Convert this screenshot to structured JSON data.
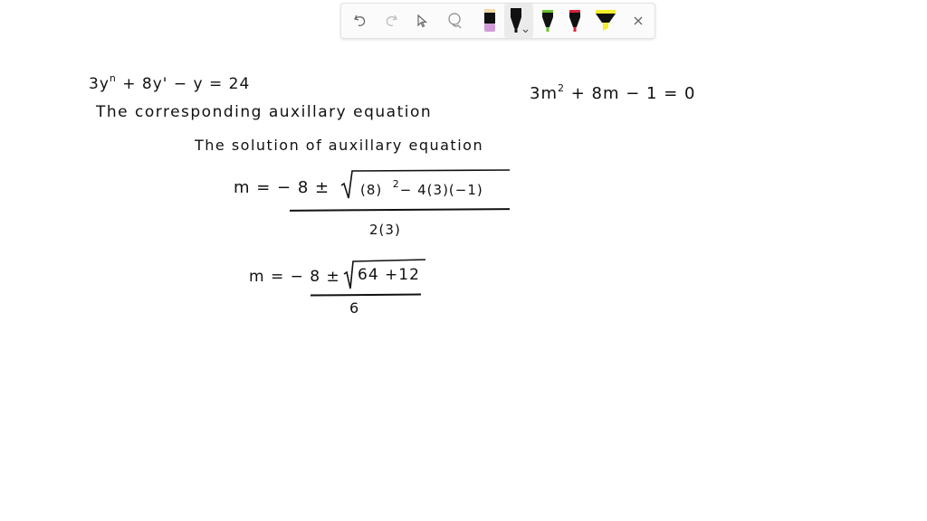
{
  "toolbar": {
    "tools": [
      {
        "name": "undo",
        "icon": "undo-icon"
      },
      {
        "name": "redo",
        "icon": "redo-icon"
      },
      {
        "name": "select",
        "icon": "cursor-icon"
      },
      {
        "name": "lasso",
        "icon": "lasso-icon"
      },
      {
        "name": "eraser-pen",
        "icon": "pen-icon",
        "color": "#cf9ad6",
        "cap_color": "#f1d9a8"
      },
      {
        "name": "black-pen",
        "icon": "pen-icon",
        "color": "#111111",
        "active": true
      },
      {
        "name": "green-pen",
        "icon": "pen-icon",
        "color": "#6bbf2e"
      },
      {
        "name": "red-pen",
        "icon": "pen-icon",
        "color": "#d8233b"
      },
      {
        "name": "highlighter",
        "icon": "highlighter-icon",
        "color": "#f5ee2a"
      },
      {
        "name": "close",
        "icon": "close-icon"
      }
    ]
  },
  "notes": {
    "line1": {
      "a": "3y",
      "b": "n",
      "c": " + 8y' − y = 24"
    },
    "line2_text": "The corresponding  auxillary  equation",
    "aux_eq": {
      "a": "3m",
      "exp": "2",
      "b": "+ 8m − 1 = 0"
    },
    "line3_text": "The solution  of  auxillary equation",
    "formula1": {
      "lhs": "m = − 8 ±",
      "radicand_a": "(8)",
      "exp": "2",
      "radicand_b": "− 4(3)(−1)",
      "denominator": "2(3)"
    },
    "formula2": {
      "lhs": "m = − 8 ±",
      "radicand": "64 +12",
      "denominator": "6"
    }
  }
}
